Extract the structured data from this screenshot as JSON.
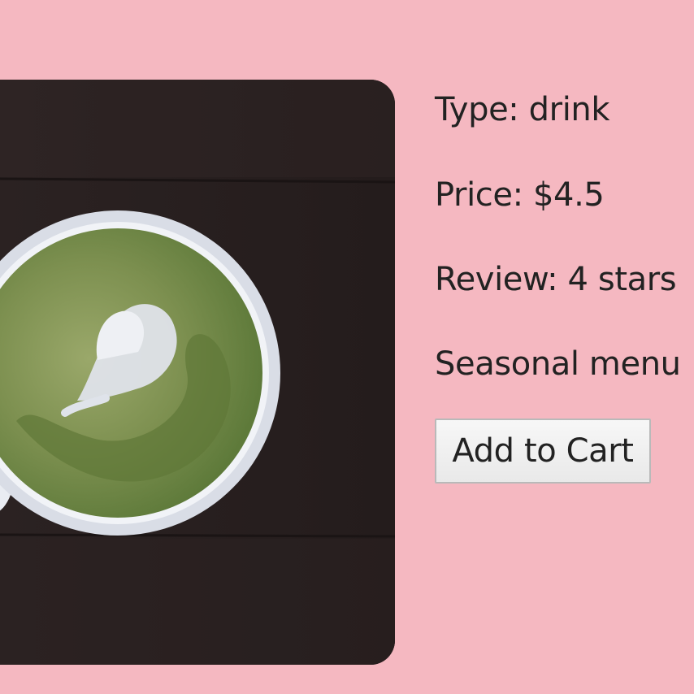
{
  "product": {
    "image_icon": "matcha-latte-photo",
    "type_text": "Type: drink",
    "price_text": "Price: $4.5",
    "review_text": "Review: 4 stars",
    "seasonal_text": "Seasonal menu"
  },
  "actions": {
    "add_to_cart_label": "Add to Cart"
  },
  "colors": {
    "page_background": "#f5b8c1",
    "text": "#222222",
    "button_border": "#b9b9b9",
    "image_background": "#2a2020"
  }
}
